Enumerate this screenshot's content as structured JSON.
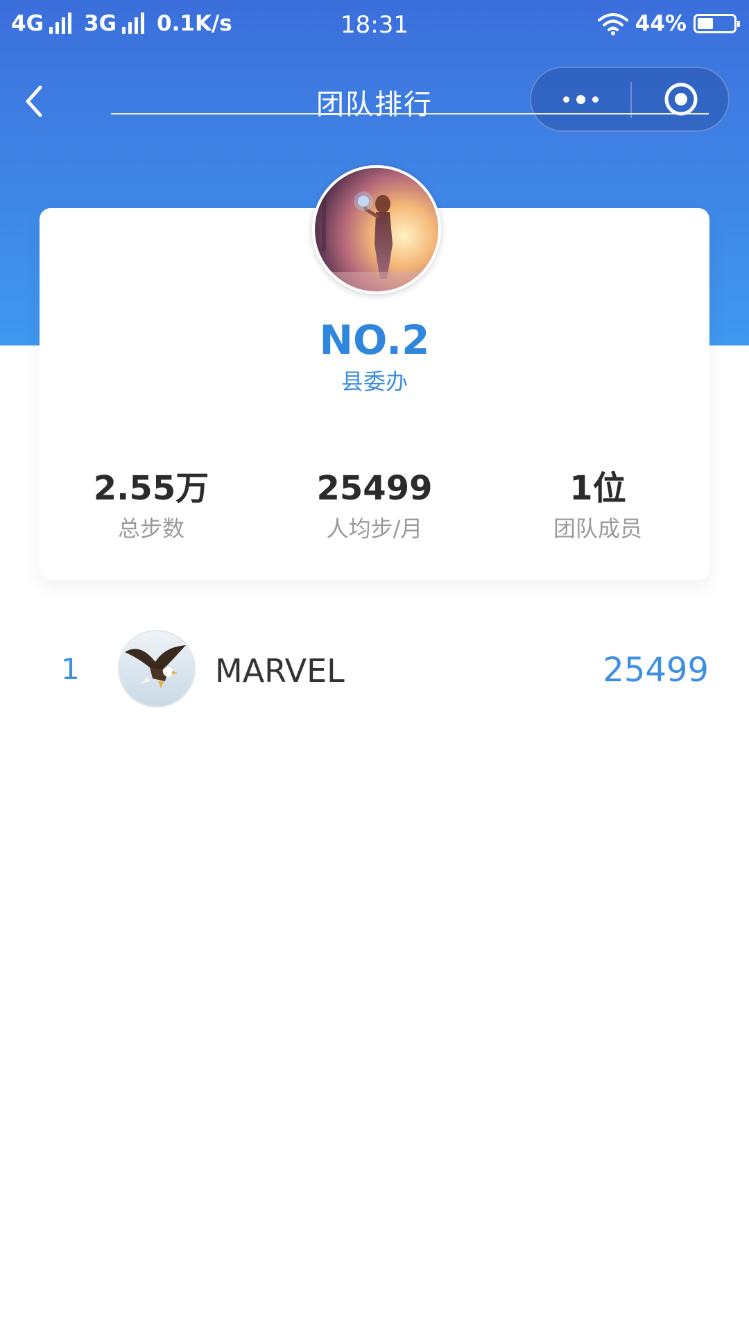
{
  "status_bar": {
    "network_1": "4G",
    "network_2": "3G",
    "speed": "0.1K/s",
    "time": "18:31",
    "battery": "44%",
    "battery_level": 0.44
  },
  "nav": {
    "back_icon": "chevron-left-icon",
    "title": "团队排行",
    "more_icon": "more-dots-icon",
    "close_icon": "target-close-icon"
  },
  "team": {
    "rank": "NO.2",
    "name": "县委办",
    "avatar_icon": "team-avatar-photo",
    "stats": [
      {
        "value": "2.55万",
        "label": "总步数"
      },
      {
        "value": "25499",
        "label": "人均步/月"
      },
      {
        "value": "1位",
        "label": "团队成员"
      }
    ]
  },
  "members": [
    {
      "rank": "1",
      "name": "MARVEL",
      "steps": "25499",
      "avatar_icon": "eagle-avatar"
    }
  ],
  "colors": {
    "header_gradient_top": "#3b6fdc",
    "header_gradient_bottom": "#3f98ef",
    "accent_blue": "#2f86dd",
    "stat_value": "#2b2b2b",
    "stat_label": "#9a9a9a"
  }
}
